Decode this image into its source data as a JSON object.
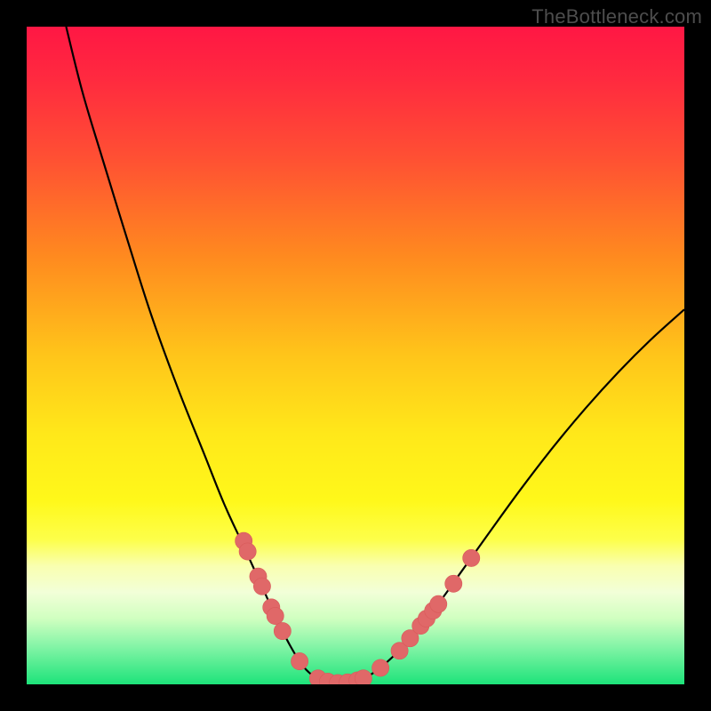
{
  "watermark": "TheBottleneck.com",
  "colors": {
    "black": "#000000",
    "curve": "#000000",
    "marker_fill": "#e06868",
    "marker_stroke": "#d85a5a"
  },
  "chart_data": {
    "type": "line",
    "title": "",
    "xlabel": "",
    "ylabel": "",
    "xlim": [
      0,
      100
    ],
    "ylim": [
      0,
      100
    ],
    "gradient_stops": [
      {
        "offset": 0.0,
        "color": "#ff1744"
      },
      {
        "offset": 0.08,
        "color": "#ff2a3f"
      },
      {
        "offset": 0.2,
        "color": "#ff5033"
      },
      {
        "offset": 0.35,
        "color": "#ff8a1f"
      },
      {
        "offset": 0.5,
        "color": "#ffc51a"
      },
      {
        "offset": 0.62,
        "color": "#ffe81a"
      },
      {
        "offset": 0.72,
        "color": "#fff81a"
      },
      {
        "offset": 0.78,
        "color": "#fdff4a"
      },
      {
        "offset": 0.82,
        "color": "#f9ffb0"
      },
      {
        "offset": 0.86,
        "color": "#f2ffd8"
      },
      {
        "offset": 0.9,
        "color": "#d0ffc0"
      },
      {
        "offset": 0.94,
        "color": "#88f5a8"
      },
      {
        "offset": 1.0,
        "color": "#1de37a"
      }
    ],
    "series": [
      {
        "name": "bottleneck-curve",
        "points": [
          {
            "x": 6.0,
            "y": 100.0
          },
          {
            "x": 8.5,
            "y": 90.0
          },
          {
            "x": 11.5,
            "y": 80.0
          },
          {
            "x": 15.5,
            "y": 67.0
          },
          {
            "x": 19.0,
            "y": 56.0
          },
          {
            "x": 23.0,
            "y": 45.0
          },
          {
            "x": 27.0,
            "y": 35.0
          },
          {
            "x": 30.0,
            "y": 27.5
          },
          {
            "x": 33.0,
            "y": 21.0
          },
          {
            "x": 35.5,
            "y": 15.5
          },
          {
            "x": 38.0,
            "y": 10.0
          },
          {
            "x": 40.0,
            "y": 6.0
          },
          {
            "x": 42.0,
            "y": 2.8
          },
          {
            "x": 44.0,
            "y": 1.0
          },
          {
            "x": 46.0,
            "y": 0.3
          },
          {
            "x": 48.0,
            "y": 0.2
          },
          {
            "x": 50.0,
            "y": 0.5
          },
          {
            "x": 52.0,
            "y": 1.3
          },
          {
            "x": 54.0,
            "y": 2.7
          },
          {
            "x": 57.0,
            "y": 5.5
          },
          {
            "x": 60.0,
            "y": 9.0
          },
          {
            "x": 63.0,
            "y": 12.8
          },
          {
            "x": 66.0,
            "y": 17.0
          },
          {
            "x": 70.0,
            "y": 22.6
          },
          {
            "x": 75.0,
            "y": 29.5
          },
          {
            "x": 80.0,
            "y": 36.0
          },
          {
            "x": 85.0,
            "y": 42.0
          },
          {
            "x": 90.0,
            "y": 47.5
          },
          {
            "x": 95.0,
            "y": 52.5
          },
          {
            "x": 100.0,
            "y": 57.0
          }
        ]
      }
    ],
    "markers": [
      {
        "x": 33.0,
        "y": 21.8,
        "r": 1.3
      },
      {
        "x": 33.6,
        "y": 20.2,
        "r": 1.3
      },
      {
        "x": 35.2,
        "y": 16.4,
        "r": 1.3
      },
      {
        "x": 35.8,
        "y": 14.9,
        "r": 1.3
      },
      {
        "x": 37.2,
        "y": 11.7,
        "r": 1.3
      },
      {
        "x": 37.8,
        "y": 10.4,
        "r": 1.3
      },
      {
        "x": 38.9,
        "y": 8.1,
        "r": 1.3
      },
      {
        "x": 41.5,
        "y": 3.5,
        "r": 1.3
      },
      {
        "x": 44.3,
        "y": 0.9,
        "r": 1.3
      },
      {
        "x": 45.8,
        "y": 0.4,
        "r": 1.3
      },
      {
        "x": 47.3,
        "y": 0.2,
        "r": 1.3
      },
      {
        "x": 48.8,
        "y": 0.3,
        "r": 1.3
      },
      {
        "x": 50.3,
        "y": 0.6,
        "r": 1.3
      },
      {
        "x": 51.2,
        "y": 0.9,
        "r": 1.3
      },
      {
        "x": 53.8,
        "y": 2.5,
        "r": 1.3
      },
      {
        "x": 56.7,
        "y": 5.1,
        "r": 1.3
      },
      {
        "x": 58.3,
        "y": 7.0,
        "r": 1.3
      },
      {
        "x": 59.9,
        "y": 8.9,
        "r": 1.3
      },
      {
        "x": 60.8,
        "y": 10.0,
        "r": 1.3
      },
      {
        "x": 61.8,
        "y": 11.2,
        "r": 1.3
      },
      {
        "x": 62.6,
        "y": 12.2,
        "r": 1.3
      },
      {
        "x": 64.9,
        "y": 15.3,
        "r": 1.3
      },
      {
        "x": 67.6,
        "y": 19.2,
        "r": 1.3
      }
    ]
  }
}
